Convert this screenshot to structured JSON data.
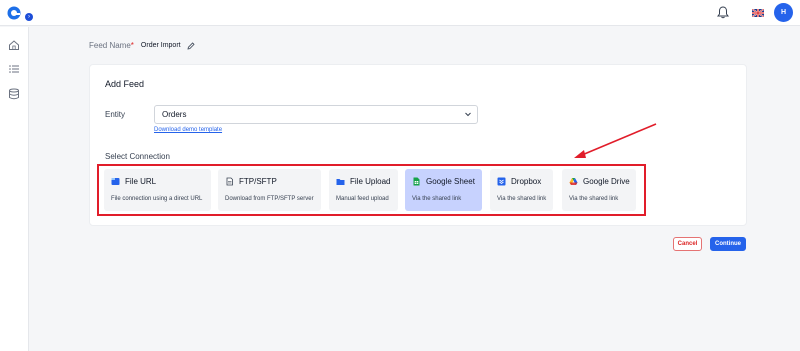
{
  "header": {
    "avatar_initial": "H",
    "icons": [
      "app-logo-icon",
      "bell-icon",
      "uk-flag-icon"
    ]
  },
  "sidebar": {
    "icons": [
      "home-icon",
      "list-icon",
      "database-icon"
    ]
  },
  "feed_name": {
    "label": "Feed Name",
    "required_mark": "*",
    "value": "Order Import"
  },
  "card": {
    "title": "Add Feed",
    "entity_label": "Entity",
    "entity_value": "Orders",
    "download_link": "Download demo template",
    "select_connection_label": "Select Connection",
    "connections": [
      {
        "label": "File URL",
        "desc": "File connection using a direct URL",
        "icon": "file-url-icon"
      },
      {
        "label": "FTP/SFTP",
        "desc": "Download from FTP/SFTP server",
        "icon": "ftp-icon"
      },
      {
        "label": "File Upload",
        "desc": "Manual feed upload",
        "icon": "folder-icon"
      },
      {
        "label": "Google Sheet",
        "desc": "Via the shared link",
        "icon": "google-sheet-icon",
        "selected": true
      },
      {
        "label": "Dropbox",
        "desc": "Via the shared link",
        "icon": "dropbox-icon"
      },
      {
        "label": "Google Drive",
        "desc": "Via the shared link",
        "icon": "google-drive-icon"
      }
    ]
  },
  "actions": {
    "cancel": "Cancel",
    "continue": "Continue"
  },
  "colors": {
    "accent": "#2563eb",
    "highlight_border": "#e11d2a",
    "selected_tile": "#c7d2fe"
  }
}
